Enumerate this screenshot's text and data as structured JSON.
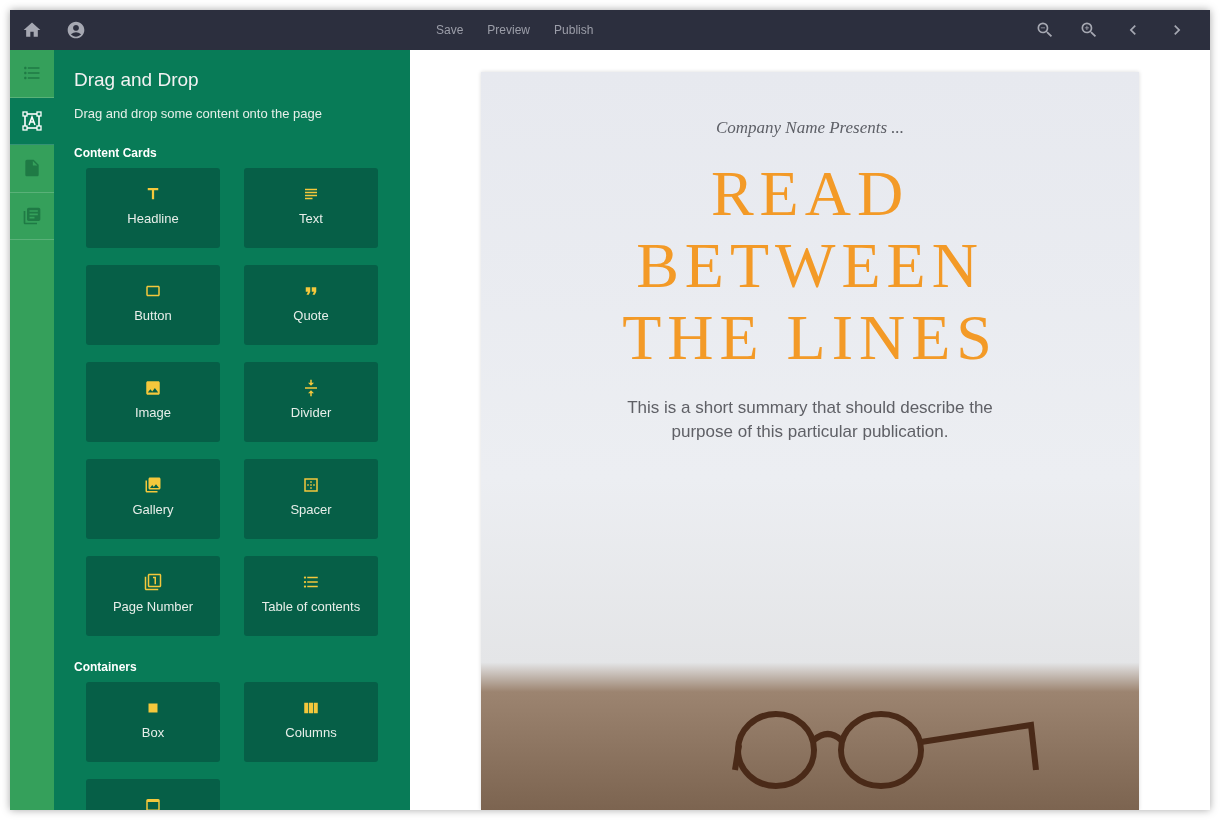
{
  "toolbar": {
    "left": [
      {
        "kind": "home"
      },
      {
        "kind": "account"
      }
    ],
    "links": [
      "Save",
      "Preview",
      "Publish"
    ],
    "right": [
      {
        "kind": "zoom_out"
      },
      {
        "kind": "zoom_in"
      },
      {
        "kind": "prev"
      },
      {
        "kind": "next"
      }
    ]
  },
  "rail": [
    {
      "kind": "list",
      "selected": false
    },
    {
      "kind": "text_frame",
      "selected": true
    },
    {
      "kind": "page",
      "selected": false
    },
    {
      "kind": "pages",
      "selected": false
    }
  ],
  "panel": {
    "title": "Drag and Drop",
    "subtitle": "Drag and drop some content onto the page",
    "sections": [
      {
        "title": "Content Cards",
        "cards": [
          {
            "kind": "headline",
            "label": "Headline"
          },
          {
            "kind": "text",
            "label": "Text"
          },
          {
            "kind": "button",
            "label": "Button"
          },
          {
            "kind": "quote",
            "label": "Quote"
          },
          {
            "kind": "image",
            "label": "Image"
          },
          {
            "kind": "divider",
            "label": "Divider"
          },
          {
            "kind": "gallery",
            "label": "Gallery"
          },
          {
            "kind": "spacer",
            "label": "Spacer"
          },
          {
            "kind": "page_number",
            "label": "Page Number"
          },
          {
            "kind": "toc",
            "label": "Table of contents"
          }
        ]
      },
      {
        "title": "Containers",
        "cards": [
          {
            "kind": "box",
            "label": "Box"
          },
          {
            "kind": "columns",
            "label": "Columns"
          },
          {
            "kind": "header"
          }
        ]
      }
    ]
  },
  "cover": {
    "kicker": "Company Name Presents ...",
    "title_lines": [
      "READ",
      "BETWEEN",
      "THE LINES"
    ],
    "summary": "This is a short summary that should describe the purpose of this particular publication."
  }
}
